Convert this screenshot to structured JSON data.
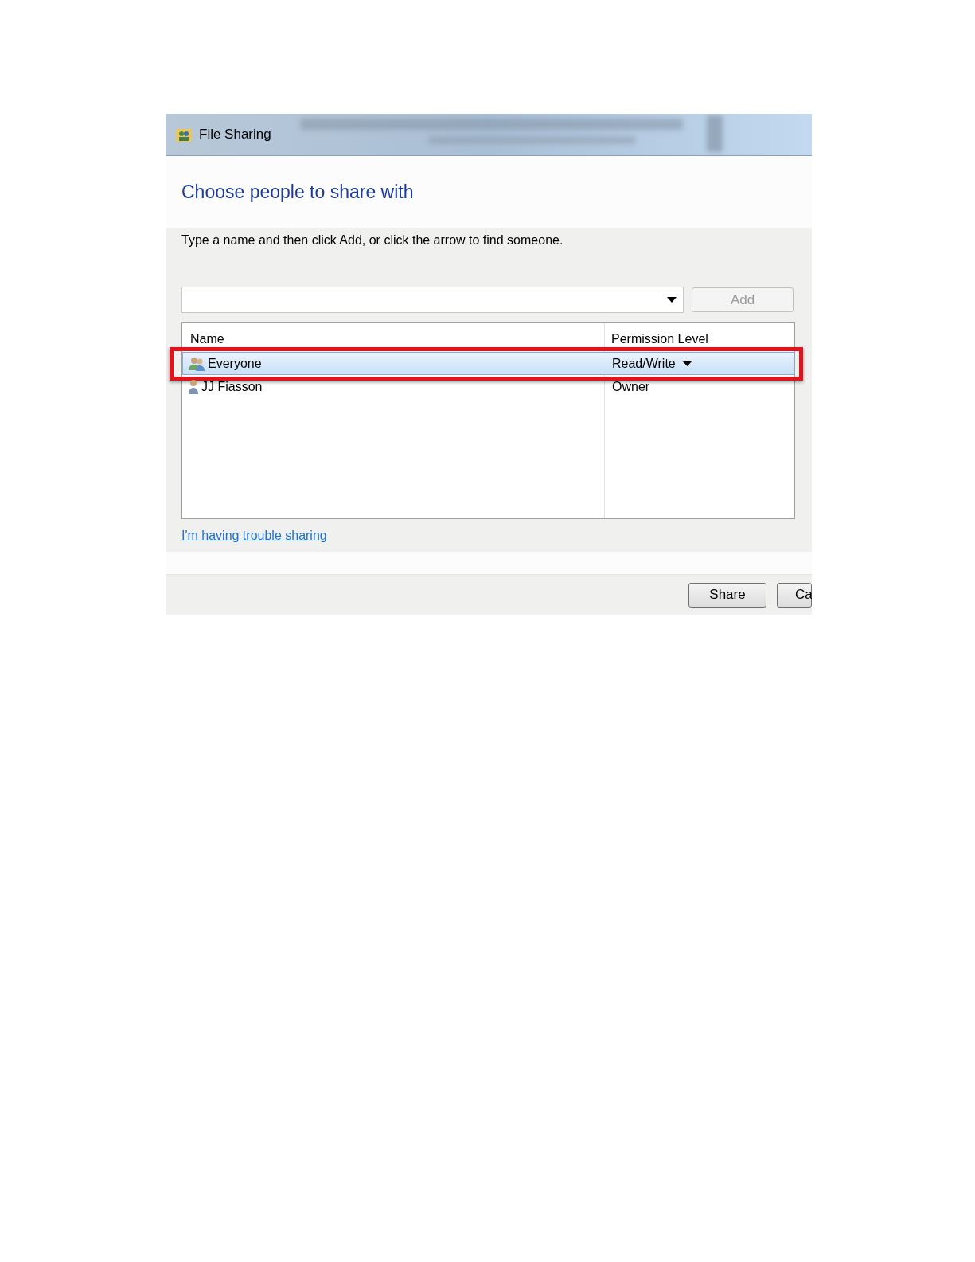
{
  "window": {
    "title": "File Sharing"
  },
  "heading": "Choose people to share with",
  "instruction": "Type a name and then click Add, or click the arrow to find someone.",
  "add_button": {
    "label": "Add",
    "disabled": true
  },
  "list": {
    "columns": [
      "Name",
      "Permission Level"
    ],
    "rows": [
      {
        "kind": "group",
        "name": "Everyone",
        "permission": "Read/Write",
        "dropdown": true,
        "selected": true,
        "highlighted": true
      },
      {
        "kind": "user",
        "name": "JJ Fiasson",
        "permission": "Owner",
        "dropdown": false,
        "selected": false,
        "highlighted": false
      }
    ]
  },
  "help_link": "I'm having trouble sharing",
  "buttons": [
    {
      "label": "Share"
    },
    {
      "label": "Ca"
    }
  ]
}
